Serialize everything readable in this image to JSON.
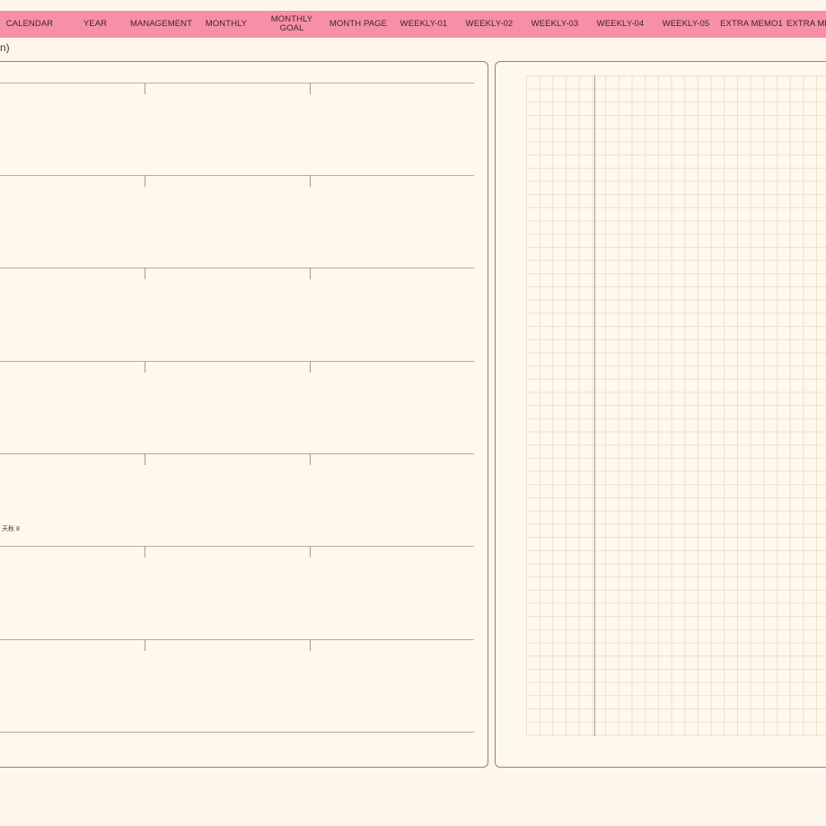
{
  "nav": {
    "tabs": [
      {
        "label": "CALENDAR"
      },
      {
        "label": "YEAR"
      },
      {
        "label": "MANAGEMENT"
      },
      {
        "label": "MONTHLY"
      },
      {
        "label": "MONTHLY\nGOAL"
      },
      {
        "label": "MONTH PAGE"
      },
      {
        "label": "WEEKLY-01"
      },
      {
        "label": "WEEKLY-02"
      },
      {
        "label": "WEEKLY-03"
      },
      {
        "label": "WEEKLY-04"
      },
      {
        "label": "WEEKLY-05"
      },
      {
        "label": "EXTRA MEMO1"
      },
      {
        "label": "EXTRA ME"
      }
    ],
    "bg_color": "#f78fa7"
  },
  "page_indicator": "n)",
  "left_panel": {
    "note": "天秋 8"
  },
  "colors": {
    "background": "#fef6ea",
    "panel_border": "#8f8474",
    "grid_line": "#ebe0cc"
  }
}
